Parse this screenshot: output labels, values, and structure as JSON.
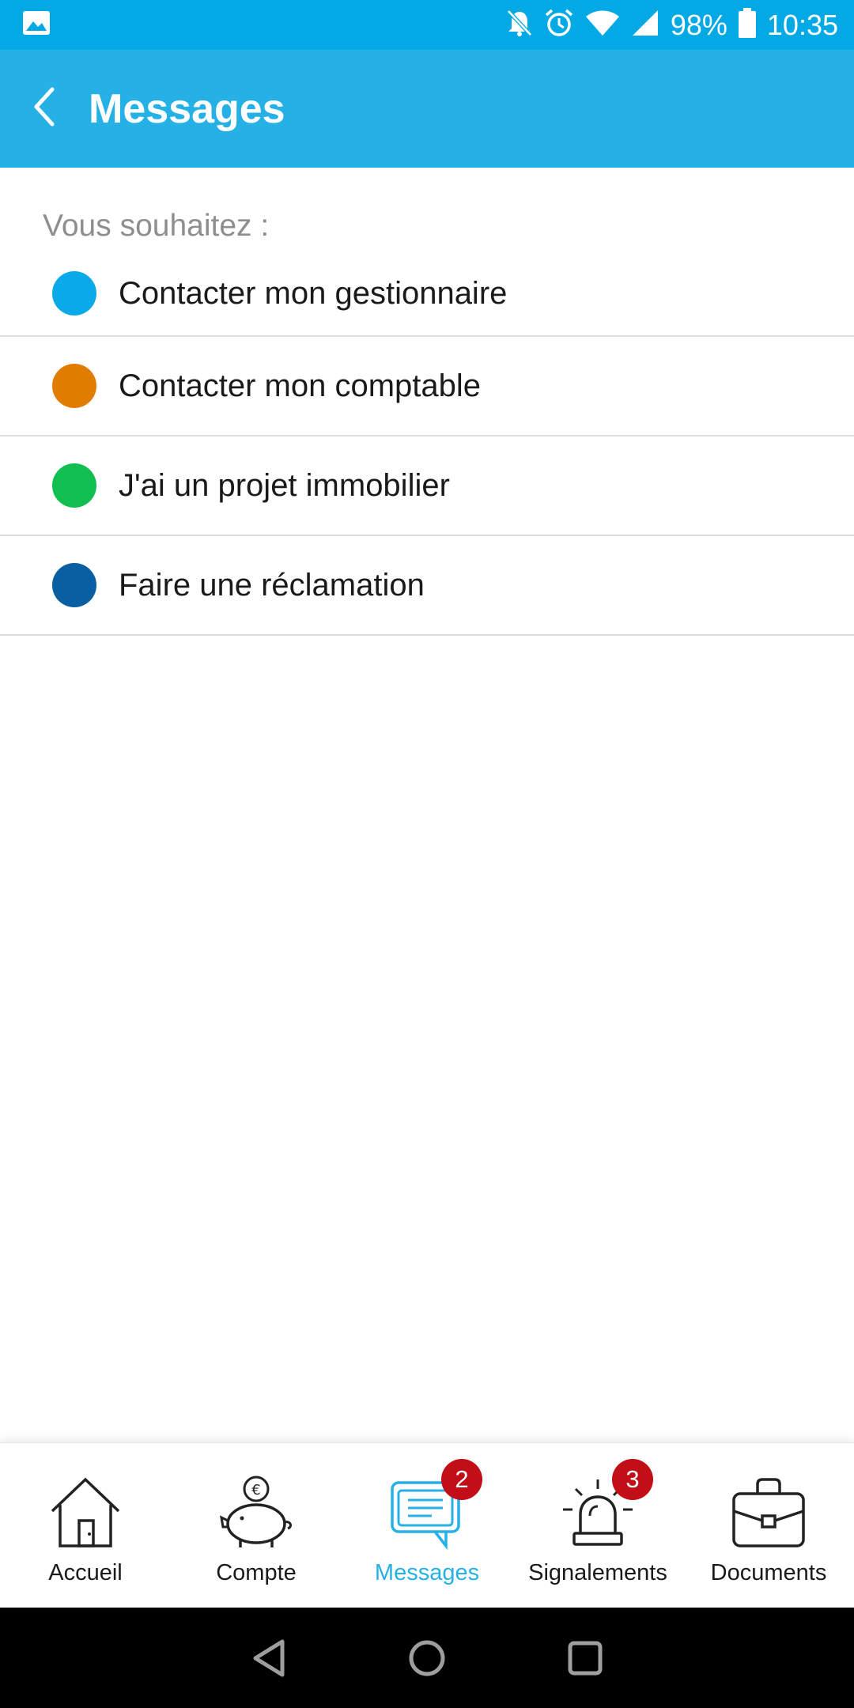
{
  "status_bar": {
    "battery": "98%",
    "time": "10:35",
    "icons": [
      "image-icon",
      "bell-off-icon",
      "alarm-icon",
      "wifi-icon",
      "signal-icon",
      "battery-icon"
    ]
  },
  "app_bar": {
    "title": "Messages",
    "back_icon": "back-arrow-icon",
    "color": "#26b1e6"
  },
  "content": {
    "prompt": "Vous souhaitez :",
    "options": [
      {
        "label": "Contacter mon gestionnaire",
        "color": "#0aa9e8"
      },
      {
        "label": "Contacter mon comptable",
        "color": "#e07d00"
      },
      {
        "label": "J'ai un projet immobilier",
        "color": "#10bf4f"
      },
      {
        "label": "Faire une réclamation",
        "color": "#0a5fa3"
      }
    ]
  },
  "bottom_nav": {
    "items": [
      {
        "label": "Accueil",
        "icon": "house-icon",
        "active": false
      },
      {
        "label": "Compte",
        "icon": "piggy-bank-icon",
        "active": false
      },
      {
        "label": "Messages",
        "icon": "chat-icon",
        "active": true,
        "badge": "2"
      },
      {
        "label": "Signalements",
        "icon": "siren-icon",
        "active": false,
        "badge": "3"
      },
      {
        "label": "Documents",
        "icon": "briefcase-icon",
        "active": false
      }
    ],
    "active_color": "#26b1e6",
    "badge_color": "#c20e17"
  },
  "system_nav": {
    "icons": [
      "back-triangle-icon",
      "home-circle-icon",
      "recents-square-icon"
    ]
  }
}
